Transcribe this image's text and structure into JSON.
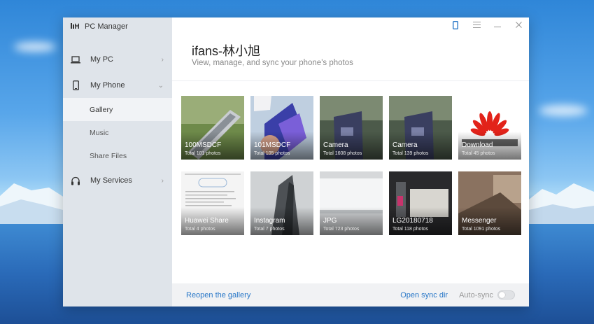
{
  "app": {
    "title": "PC Manager",
    "logo_icon": "huawei-pc-manager-logo"
  },
  "window_controls": {
    "phone_icon": "phone-icon",
    "menu_icon": "menu-icon",
    "minimize_icon": "minimize-icon",
    "close_icon": "close-icon"
  },
  "sidebar": {
    "items": [
      {
        "label": "My PC",
        "icon": "laptop-icon",
        "chevron": "›"
      },
      {
        "label": "My Phone",
        "icon": "phone-icon",
        "chevron": "⌄"
      },
      {
        "label": "My Services",
        "icon": "headset-icon",
        "chevron": "›"
      }
    ],
    "subitems": [
      {
        "label": "Gallery",
        "active": true
      },
      {
        "label": "Music",
        "active": false
      },
      {
        "label": "Share Files",
        "active": false
      }
    ]
  },
  "header": {
    "title": "ifans-林小旭",
    "subtitle": "View, manage, and sync your phone's photos"
  },
  "albums": [
    {
      "name": "100MSDCF",
      "count": "Total 101 photos"
    },
    {
      "name": "101MSDCF",
      "count": "Total 105 photos"
    },
    {
      "name": "Camera",
      "count": "Total 1608 photos"
    },
    {
      "name": "Camera",
      "count": "Total 139 photos"
    },
    {
      "name": "Download",
      "count": "Total 45 photos"
    },
    {
      "name": "Huawei Share",
      "count": "Total 4 photos"
    },
    {
      "name": "Instagram",
      "count": "Total 7 photos"
    },
    {
      "name": "JPG",
      "count": "Total 723 photos"
    },
    {
      "name": "LG20180718",
      "count": "Total 118 photos"
    },
    {
      "name": "Messenger",
      "count": "Total 1091 photos"
    }
  ],
  "footer": {
    "reopen_label": "Reopen the gallery",
    "open_sync_label": "Open sync dir",
    "auto_sync_label": "Auto-sync",
    "auto_sync_on": false
  },
  "colors": {
    "accent": "#2a78c8",
    "sidebar_bg": "#dfe4ea",
    "huawei_red": "#e2231a"
  }
}
